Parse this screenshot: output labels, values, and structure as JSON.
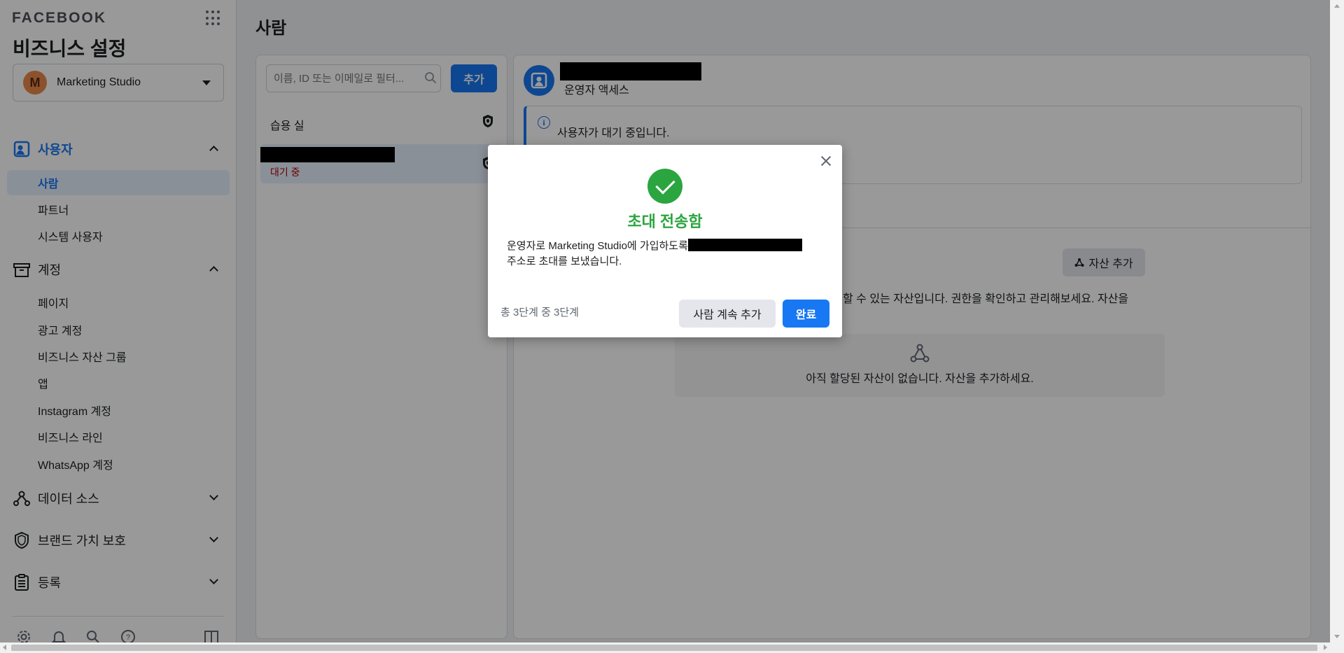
{
  "sidebar": {
    "brand": "FACEBOOK",
    "title": "비즈니스 설정",
    "business": {
      "avatar_letter": "M",
      "name": "Marketing Studio"
    },
    "sections": {
      "users": {
        "label": "사용자",
        "icon": "users-icon",
        "items": [
          "사람",
          "파트너",
          "시스템 사용자"
        ]
      },
      "accounts": {
        "label": "계정",
        "icon": "box-icon",
        "items": [
          "페이지",
          "광고 계정",
          "비즈니스 자산 그룹",
          "앱",
          "Instagram 계정",
          "비즈니스 라인",
          "WhatsApp 계정"
        ]
      },
      "data_sources": {
        "label": "데이터 소스",
        "icon": "data-sources-icon"
      },
      "brand_safety": {
        "label": "브랜드 가치 보호",
        "icon": "shield-icon"
      },
      "registration": {
        "label": "등록",
        "icon": "clipboard-icon"
      }
    },
    "bottom_icons": [
      "settings-icon",
      "bell-icon",
      "search-icon",
      "help-icon",
      "panel-icon"
    ]
  },
  "main": {
    "page_title": "사람",
    "search_placeholder": "이름, ID 또는 이메일로 필터...",
    "add_label": "추가",
    "people": [
      {
        "name": "습용 실",
        "status": ""
      },
      {
        "name": "",
        "status": "대기 중"
      }
    ]
  },
  "detail": {
    "role": "운영자 액세스",
    "info_text": "사용자가 대기 중입니다.",
    "add_asset_label": "자산 추가",
    "asset_description": "할 수 있는 자산입니다. 권한을 확인하고 관리해보세요. 자산을",
    "empty_text": "아직 할당된 자산이 없습니다. 자산을 추가하세요."
  },
  "modal": {
    "title": "초대 전송함",
    "body_line1": "운영자로 Marketing Studio에 가입하도록",
    "body_line2": "주소로 초대를 보냈습니다.",
    "step": "총 3단계 중 3단계",
    "continue_label": "사람 계속 추가",
    "done_label": "완료"
  },
  "colors": {
    "accent": "#1877f2",
    "success": "#2ba53f",
    "pending": "#b30000"
  }
}
